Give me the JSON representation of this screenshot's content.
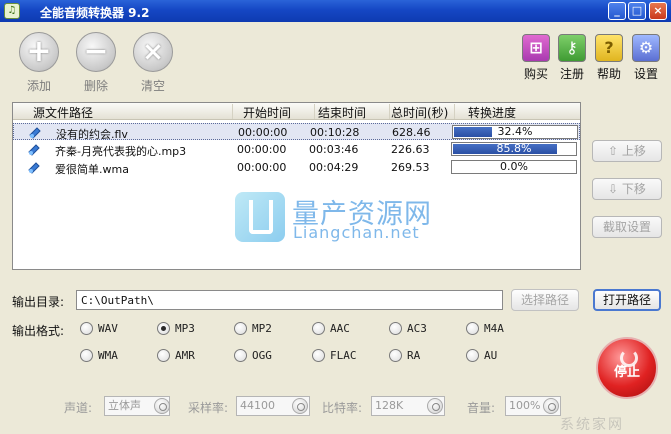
{
  "window": {
    "title": "全能音频转换器 9.2"
  },
  "toolbar": {
    "add_label": "添加",
    "delete_label": "删除",
    "clear_label": "清空",
    "buy_label": "购买",
    "register_label": "注册",
    "help_label": "帮助",
    "settings_label": "设置"
  },
  "table": {
    "columns": [
      "源文件路径",
      "开始时间",
      "结束时间",
      "总时间(秒)",
      "转换进度"
    ],
    "rows": [
      {
        "file": "没有的约会.flv",
        "start": "00:00:00",
        "end": "00:10:28",
        "total": "628.46",
        "progress_text": "32.4%",
        "progress": 0.324,
        "selected": true
      },
      {
        "file": "齐秦-月亮代表我的心.mp3",
        "start": "00:00:00",
        "end": "00:03:46",
        "total": "226.63",
        "progress_text": "85.8%",
        "progress": 0.858,
        "selected": false
      },
      {
        "file": "爱很简单.wma",
        "start": "00:00:00",
        "end": "00:04:29",
        "total": "269.53",
        "progress_text": "0.0%",
        "progress": 0.0,
        "selected": false
      }
    ]
  },
  "side": {
    "up_label": "上移",
    "down_label": "下移",
    "trim_label": "截取设置"
  },
  "watermark": {
    "cn": "量产资源网",
    "en": "Liangchan.net"
  },
  "output": {
    "dir_label": "输出目录:",
    "dir_value": "C:\\OutPath\\",
    "choose_label": "选择路径",
    "open_label": "打开路径",
    "format_label": "输出格式:",
    "formats": [
      "WAV",
      "MP3",
      "MP2",
      "AAC",
      "AC3",
      "M4A",
      "WMA",
      "AMR",
      "OGG",
      "FLAC",
      "RA",
      "AU"
    ],
    "selected_format": "MP3"
  },
  "params": {
    "channel_label": "声道:",
    "channel_value": "立体声",
    "samplerate_label": "采样率:",
    "samplerate_value": "44100",
    "bitrate_label": "比特率:",
    "bitrate_value": "128K",
    "volume_label": "音量:",
    "volume_value": "100%"
  },
  "stop_label": "停止",
  "corner_watermark": "系统家网",
  "colors": {
    "titlebar": "#1547c4",
    "progress": "#2a4fa4",
    "stop": "#e02222",
    "window_bg": "#ece9d8"
  }
}
